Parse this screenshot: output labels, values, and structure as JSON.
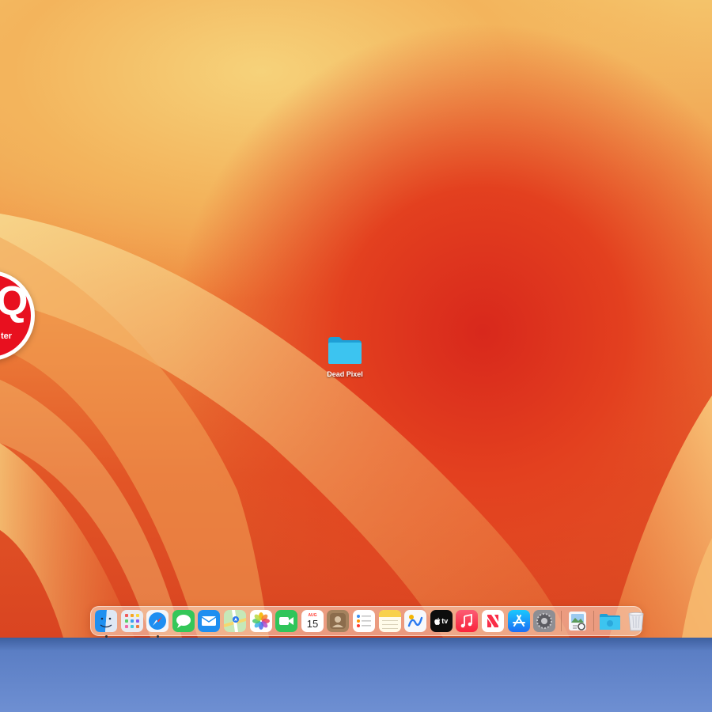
{
  "desktop": {
    "folder": {
      "label": "Dead Pixel",
      "icon": "folder-icon",
      "color": "#32b8e8"
    },
    "badge": {
      "letter": "Q",
      "text": "ter",
      "color": "#e8101f"
    }
  },
  "dock": {
    "apps": [
      {
        "name": "Finder",
        "icon": "finder-icon",
        "running": true
      },
      {
        "name": "Launchpad",
        "icon": "launchpad-icon",
        "running": false
      },
      {
        "name": "Safari",
        "icon": "safari-icon",
        "running": true
      },
      {
        "name": "Messages",
        "icon": "messages-icon",
        "running": false
      },
      {
        "name": "Mail",
        "icon": "mail-icon",
        "running": false
      },
      {
        "name": "Maps",
        "icon": "maps-icon",
        "running": false
      },
      {
        "name": "Photos",
        "icon": "photos-icon",
        "running": false
      },
      {
        "name": "FaceTime",
        "icon": "facetime-icon",
        "running": false
      },
      {
        "name": "Calendar",
        "icon": "calendar-icon",
        "month": "AUG",
        "day": "15",
        "running": false
      },
      {
        "name": "Contacts",
        "icon": "contacts-icon",
        "running": false
      },
      {
        "name": "Reminders",
        "icon": "reminders-icon",
        "running": false
      },
      {
        "name": "Notes",
        "icon": "notes-icon",
        "running": false
      },
      {
        "name": "Freeform",
        "icon": "freeform-icon",
        "running": false
      },
      {
        "name": "TV",
        "icon": "appletv-icon",
        "label": "tv",
        "running": false
      },
      {
        "name": "Music",
        "icon": "music-icon",
        "running": false
      },
      {
        "name": "News",
        "icon": "news-icon",
        "running": false
      },
      {
        "name": "App Store",
        "icon": "appstore-icon",
        "running": false
      },
      {
        "name": "System Settings",
        "icon": "settings-icon",
        "running": false
      }
    ],
    "utilities": [
      {
        "name": "Preview",
        "icon": "preview-icon"
      }
    ],
    "folders": [
      {
        "name": "Downloads",
        "icon": "downloads-folder-icon"
      },
      {
        "name": "Trash",
        "icon": "trash-icon"
      }
    ]
  },
  "colors": {
    "wallpaper_yellow": "#f4c36a",
    "wallpaper_orange": "#ef8a3f",
    "wallpaper_red": "#d8281c",
    "desk": "#6e8fd2"
  }
}
